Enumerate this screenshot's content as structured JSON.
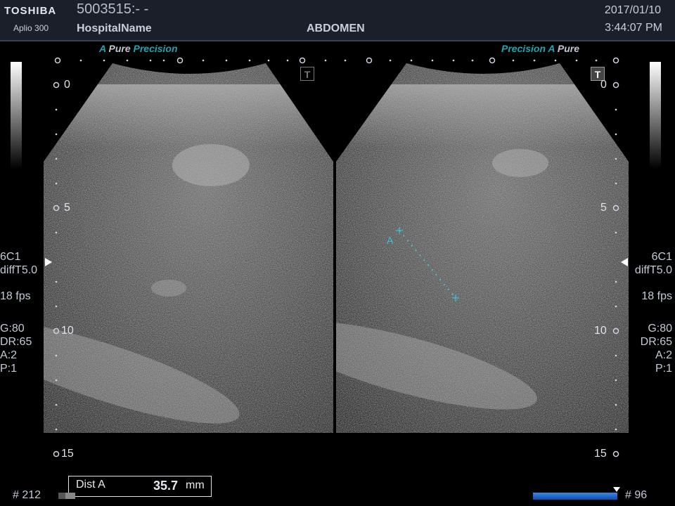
{
  "header": {
    "brand": "TOSHIBA",
    "model": "Aplio 300",
    "patient_id": "5003515:- -",
    "hospital": "HospitalName",
    "preset": "ABDOMEN",
    "date": "2017/01/10",
    "time": "3:44:07 PM"
  },
  "left_panel": {
    "brand_a": "A",
    "brand_pure": "Pure",
    "brand_precision": "Precision",
    "probe": "6C1",
    "freq": "diffT5.0",
    "fps": "18 fps",
    "gain": "G:80",
    "dr": "DR:65",
    "a": "A:2",
    "p": "P:1",
    "t_icon": "T"
  },
  "right_panel": {
    "brand_a": "A",
    "brand_pure": "Pure",
    "brand_precision": "Precision",
    "probe": "6C1",
    "freq": "diffT5.0",
    "fps": "18 fps",
    "gain": "G:80",
    "dr": "DR:65",
    "a": "A:2",
    "p": "P:1",
    "t_icon": "T"
  },
  "depth_marks": [
    "0",
    "5",
    "10",
    "15"
  ],
  "measurement": {
    "caliper_label": "A",
    "label": "Dist A",
    "value": "35.7",
    "unit": "mm"
  },
  "footer": {
    "frame_left": "# 212",
    "frame_right": "# 96"
  },
  "colors": {
    "header_bg": "#1a1f2a",
    "accent_teal": "#1fa4b0",
    "caliper": "#3cc7d6",
    "cine_bar": "#2a6fd0"
  }
}
